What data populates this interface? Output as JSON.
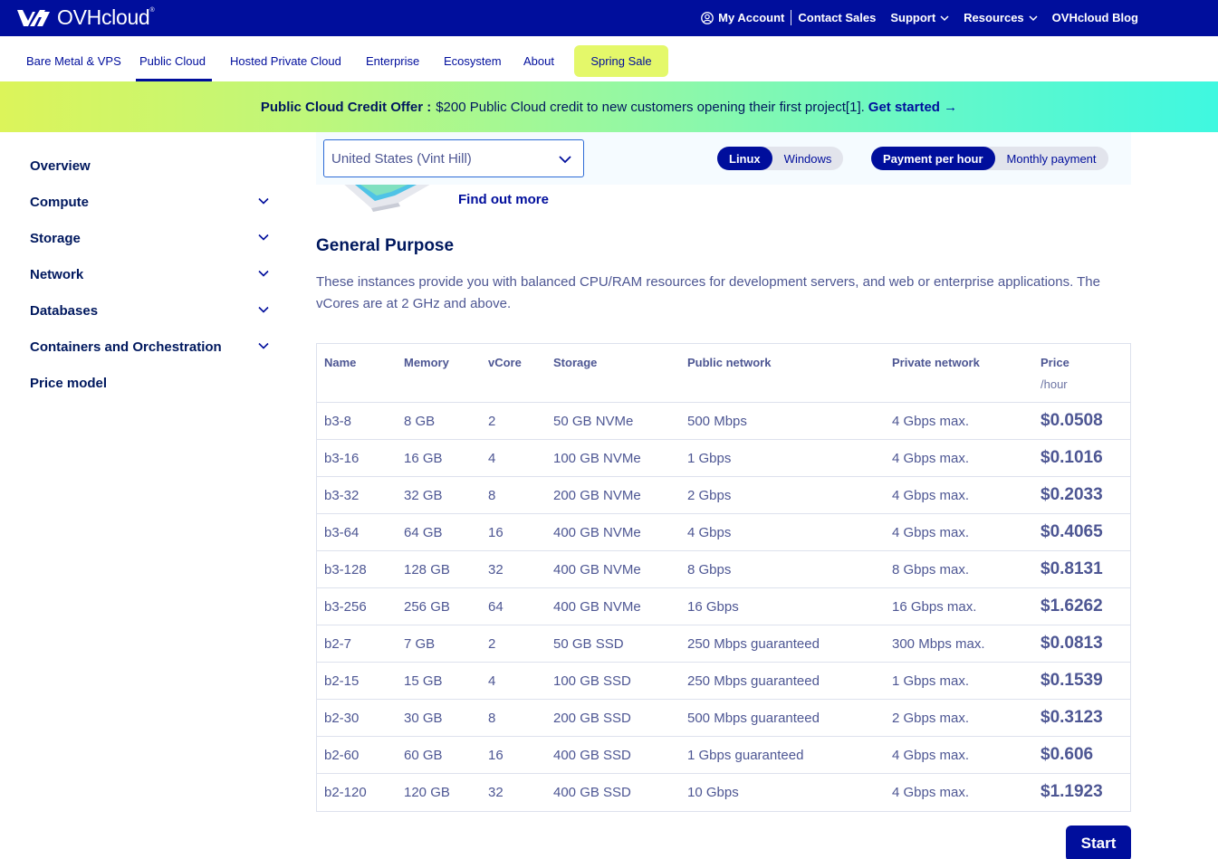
{
  "brand": {
    "name": "OVHcloud",
    "mark": "®"
  },
  "topnav": {
    "account": "My Account",
    "contact": "Contact Sales",
    "support": "Support",
    "resources": "Resources",
    "blog": "OVHcloud Blog"
  },
  "mainnav": {
    "items": [
      "Bare Metal & VPS",
      "Public Cloud",
      "Hosted Private Cloud",
      "Enterprise",
      "Ecosystem",
      "About"
    ],
    "active": "Public Cloud",
    "sale": "Spring Sale"
  },
  "banner": {
    "bold": "Public Cloud Credit Offer :",
    "text": "$200 Public Cloud credit to new customers opening their first project[1].",
    "link": "Get started →"
  },
  "sidebar": {
    "items": [
      "Overview",
      "Compute",
      "Storage",
      "Network",
      "Databases",
      "Containers and Orchestration",
      "Price model"
    ]
  },
  "filters": {
    "region": "United States (Vint Hill)",
    "os_options": [
      "Linux",
      "Windows"
    ],
    "os_selected": "Linux",
    "payment_options": [
      "Payment per hour",
      "Monthly payment"
    ],
    "payment_selected": "Payment per hour"
  },
  "find_out_more": "Find out more",
  "section": {
    "title": "General Purpose",
    "description": "These instances provide you with balanced CPU/RAM resources for development servers, and web or enterprise applications. The vCores are at 2 GHz and above."
  },
  "table": {
    "headers": [
      "Name",
      "Memory",
      "vCore",
      "Storage",
      "Public network",
      "Private network",
      "Price"
    ],
    "price_unit": "/hour",
    "rows": [
      [
        "b3-8",
        "8 GB",
        "2",
        "50 GB NVMe",
        "500 Mbps",
        "4 Gbps max.",
        "$0.0508"
      ],
      [
        "b3-16",
        "16 GB",
        "4",
        "100 GB NVMe",
        "1 Gbps",
        "4 Gbps max.",
        "$0.1016"
      ],
      [
        "b3-32",
        "32 GB",
        "8",
        "200 GB NVMe",
        "2 Gbps",
        "4 Gbps max.",
        "$0.2033"
      ],
      [
        "b3-64",
        "64 GB",
        "16",
        "400 GB NVMe",
        "4 Gbps",
        "4 Gbps max.",
        "$0.4065"
      ],
      [
        "b3-128",
        "128 GB",
        "32",
        "400 GB NVMe",
        "8 Gbps",
        "8 Gbps max.",
        "$0.8131"
      ],
      [
        "b3-256",
        "256 GB",
        "64",
        "400 GB NVMe",
        "16 Gbps",
        "16 Gbps max.",
        "$1.6262"
      ],
      [
        "b2-7",
        "7 GB",
        "2",
        "50 GB SSD",
        "250 Mbps guaranteed",
        "300 Mbps max.",
        "$0.0813"
      ],
      [
        "b2-15",
        "15 GB",
        "4",
        "100 GB SSD",
        "250 Mbps guaranteed",
        "1 Gbps max.",
        "$0.1539"
      ],
      [
        "b2-30",
        "30 GB",
        "8",
        "200 GB SSD",
        "500 Mbps guaranteed",
        "2 Gbps max.",
        "$0.3123"
      ],
      [
        "b2-60",
        "60 GB",
        "16",
        "400 GB SSD",
        "1 Gbps guaranteed",
        "4 Gbps max.",
        "$0.606"
      ],
      [
        "b2-120",
        "120 GB",
        "32",
        "400 GB SSD",
        "10 Gbps",
        "4 Gbps max.",
        "$1.1923"
      ]
    ]
  },
  "start_button": "Start",
  "colors": {
    "brand_navy": "#000e9c",
    "sale_yellow": "#e4f86a",
    "text_muted": "#4d5693"
  }
}
